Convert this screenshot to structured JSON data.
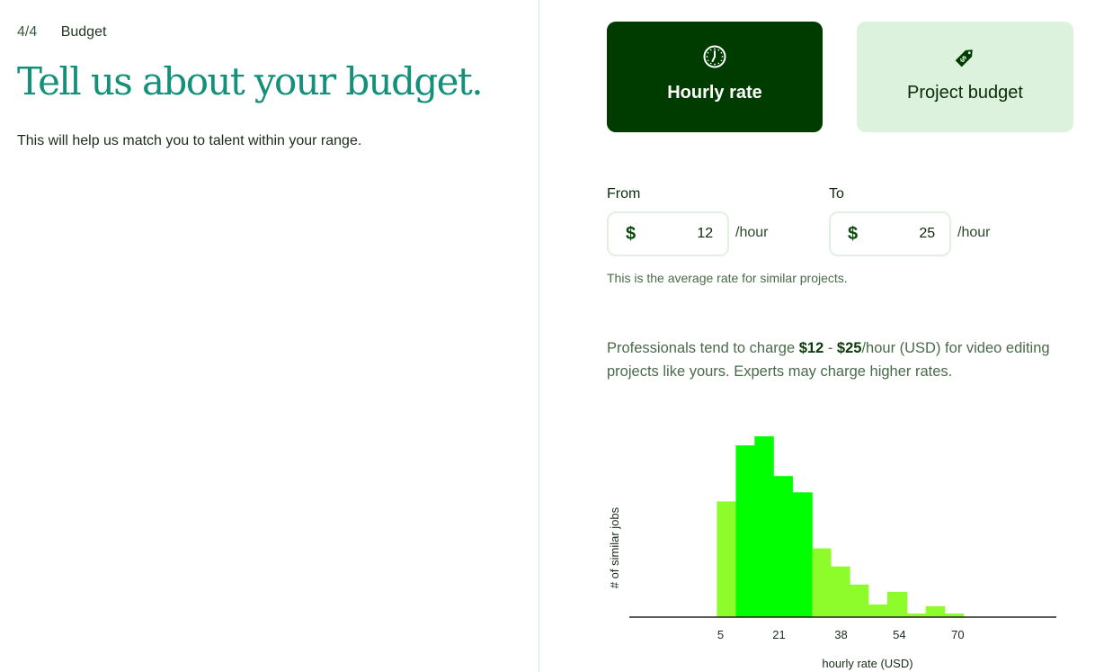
{
  "step": {
    "number": "4/4",
    "name": "Budget"
  },
  "headline": "Tell us about your budget.",
  "subtext": "This will help us match you to talent within your range.",
  "budget_types": [
    {
      "label": "Hourly rate",
      "icon": "clock-icon",
      "selected": true
    },
    {
      "label": "Project budget",
      "icon": "price-tag-icon",
      "selected": false
    }
  ],
  "rate": {
    "from": {
      "label": "From",
      "currency": "$",
      "value": "12",
      "unit": "/hour"
    },
    "to": {
      "label": "To",
      "currency": "$",
      "value": "25",
      "unit": "/hour"
    },
    "hint": "This is the average rate for similar projects."
  },
  "professionals": {
    "before": "Professionals tend to charge ",
    "range_low": "$12",
    "dash": " - ",
    "range_high": "$25",
    "after": "/hour (USD) for video editing projects like yours. Experts may charge higher rates."
  },
  "colors": {
    "accent_dark": "#003b00",
    "accent_light": "#dcf2dc",
    "headline": "#13907a",
    "bar_in_range": "#00ff00",
    "bar_out_range": "#8dfc2a"
  },
  "chart_data": {
    "type": "bar",
    "subtype": "histogram",
    "xlabel": "hourly rate (USD)",
    "ylabel": "# of similar jobs",
    "xticks": [
      5,
      21,
      38,
      54,
      70
    ],
    "xlim": [
      -20,
      97
    ],
    "ylim": [
      0,
      100
    ],
    "y_units": "relative (max = 100)",
    "bins": [
      {
        "x0": 4.0,
        "x1": 9.2,
        "value": 64,
        "highlighted": false
      },
      {
        "x0": 9.2,
        "x1": 14.3,
        "value": 95,
        "highlighted": true
      },
      {
        "x0": 14.3,
        "x1": 19.5,
        "value": 100,
        "highlighted": true
      },
      {
        "x0": 19.5,
        "x1": 24.7,
        "value": 78,
        "highlighted": true
      },
      {
        "x0": 24.7,
        "x1": 30.1,
        "value": 69,
        "highlighted": true
      },
      {
        "x0": 30.1,
        "x1": 35.2,
        "value": 38,
        "highlighted": false
      },
      {
        "x0": 35.2,
        "x1": 40.4,
        "value": 28,
        "highlighted": false
      },
      {
        "x0": 40.4,
        "x1": 45.5,
        "value": 18,
        "highlighted": false
      },
      {
        "x0": 45.5,
        "x1": 50.7,
        "value": 7,
        "highlighted": false
      },
      {
        "x0": 50.7,
        "x1": 56.1,
        "value": 14,
        "highlighted": false
      },
      {
        "x0": 56.1,
        "x1": 61.2,
        "value": 2,
        "highlighted": false
      },
      {
        "x0": 61.2,
        "x1": 66.4,
        "value": 6,
        "highlighted": false
      },
      {
        "x0": 66.4,
        "x1": 71.6,
        "value": 2,
        "highlighted": false
      }
    ]
  }
}
